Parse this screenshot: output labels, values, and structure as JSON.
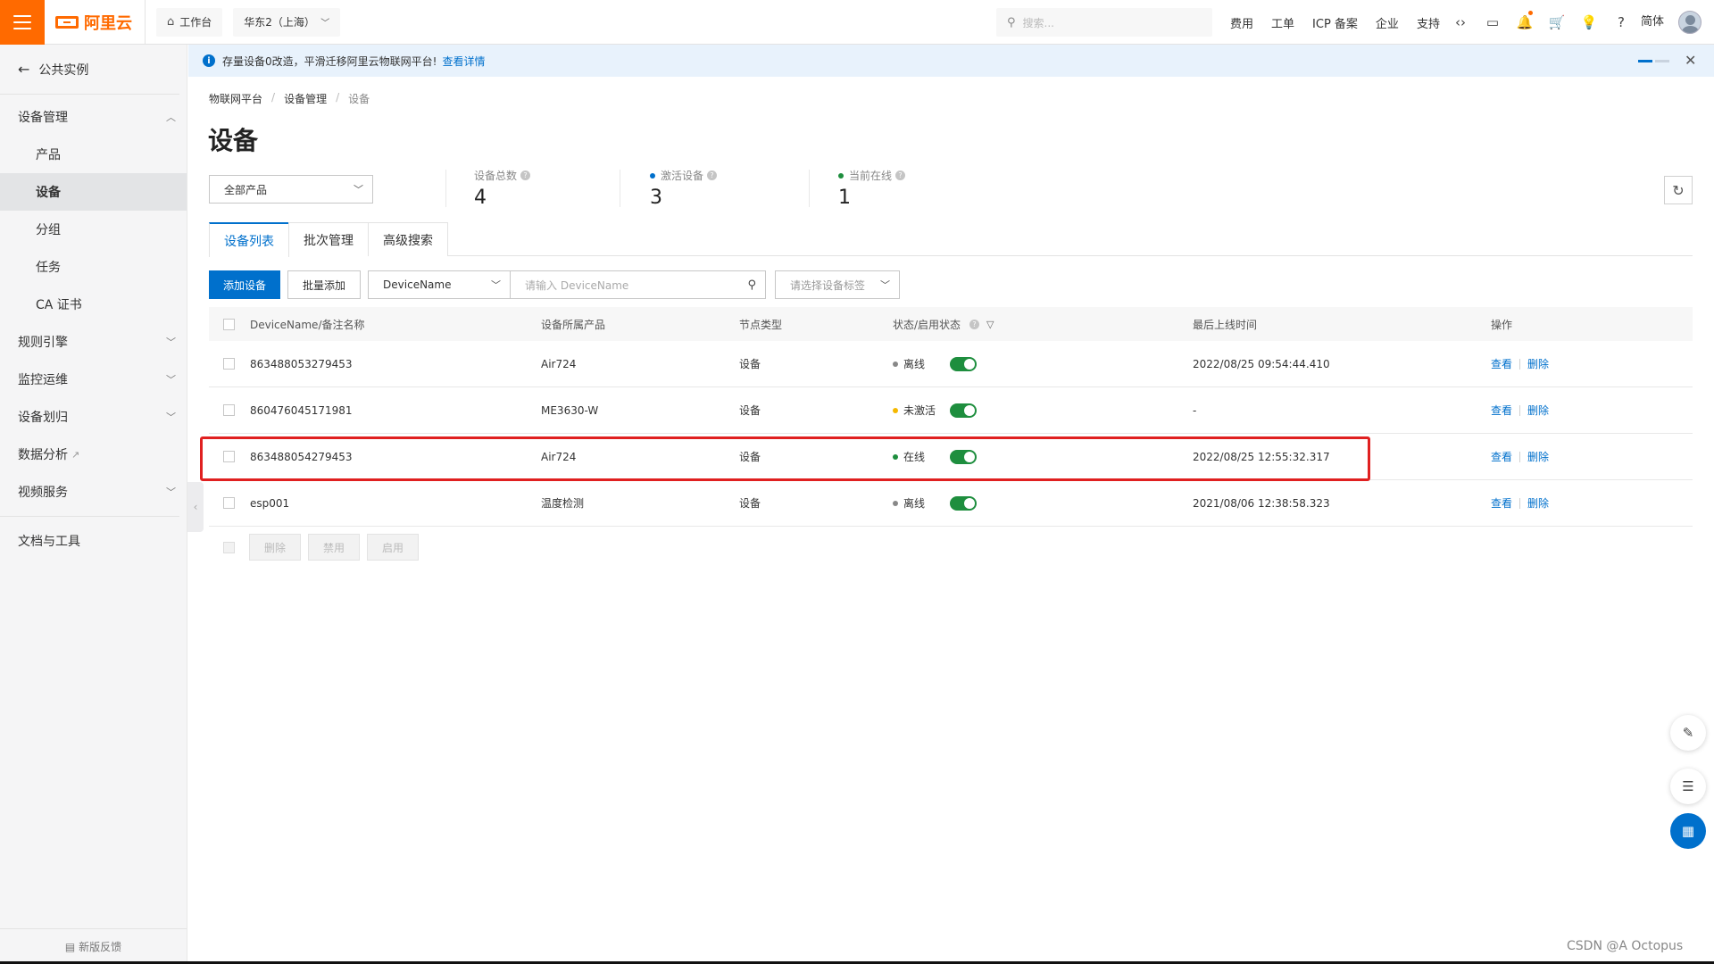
{
  "topbar": {
    "brand": "阿里云",
    "workbench": "工作台",
    "region": "华东2（上海）",
    "search_placeholder": "搜索...",
    "links": [
      "费用",
      "工单",
      "ICP 备案",
      "企业",
      "支持"
    ],
    "icons": [
      "code-icon",
      "terminal-icon",
      "bell-icon",
      "cart-icon",
      "bulb-icon",
      "help-icon"
    ],
    "language": "简体"
  },
  "sidebar": {
    "back_label": "公共实例",
    "groups": [
      {
        "label": "设备管理",
        "expanded": true,
        "items": [
          "产品",
          "设备",
          "分组",
          "任务",
          "CA 证书"
        ],
        "active": "设备"
      },
      {
        "label": "规则引擎",
        "expanded": false
      },
      {
        "label": "监控运维",
        "expanded": false
      },
      {
        "label": "设备划归",
        "expanded": false
      },
      {
        "label": "数据分析",
        "external": true
      },
      {
        "label": "视频服务",
        "expanded": false
      }
    ],
    "docs_label": "文档与工具",
    "feedback_label": "新版反馈"
  },
  "notice": {
    "text": "存量设备0改造，平滑迁移阿里云物联网平台!",
    "link": "查看详情"
  },
  "breadcrumb": [
    "物联网平台",
    "设备管理",
    "设备"
  ],
  "page_title": "设备",
  "product_filter": "全部产品",
  "stats": [
    {
      "label": "设备总数",
      "value": "4",
      "dot": ""
    },
    {
      "label": "激活设备",
      "value": "3",
      "dot": "#0070cc"
    },
    {
      "label": "当前在线",
      "value": "1",
      "dot": "#1e8e3e"
    }
  ],
  "tabs": [
    "设备列表",
    "批次管理",
    "高级搜索"
  ],
  "active_tab": "设备列表",
  "toolbar": {
    "add_device": "添加设备",
    "batch_add": "批量添加",
    "search_field": "DeviceName",
    "search_placeholder": "请输入 DeviceName",
    "tag_placeholder": "请选择设备标签"
  },
  "table": {
    "columns": [
      "DeviceName/备注名称",
      "设备所属产品",
      "节点类型",
      "状态/启用状态",
      "最后上线时间",
      "操作"
    ],
    "rows": [
      {
        "name": "863488053279453",
        "product": "Air724",
        "node": "设备",
        "status": "离线",
        "status_color": "#888888",
        "enabled": true,
        "last_online": "2022/08/25 09:54:44.410",
        "ops": [
          "查看",
          "删除"
        ]
      },
      {
        "name": "860476045171981",
        "product": "ME3630-W",
        "node": "设备",
        "status": "未激活",
        "status_color": "#f5b800",
        "enabled": true,
        "last_online": "-",
        "ops": [
          "查看",
          "删除"
        ]
      },
      {
        "name": "863488054279453",
        "product": "Air724",
        "node": "设备",
        "status": "在线",
        "status_color": "#1e8e3e",
        "enabled": true,
        "last_online": "2022/08/25 12:55:32.317",
        "ops": [
          "查看",
          "删除"
        ]
      },
      {
        "name": "esp001",
        "product": "温度检测",
        "node": "设备",
        "status": "离线",
        "status_color": "#888888",
        "enabled": true,
        "last_online": "2021/08/06 12:38:58.323",
        "ops": [
          "查看",
          "删除"
        ]
      }
    ]
  },
  "bulk_actions": [
    "删除",
    "禁用",
    "启用"
  ],
  "watermark": "CSDN @A   Octopus",
  "colors": {
    "brand": "#ff6a00",
    "primary": "#0070cc",
    "online": "#1e8e3e",
    "highlight": "#e02020"
  }
}
